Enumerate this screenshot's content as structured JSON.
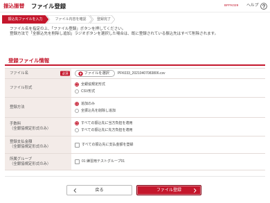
{
  "colors": {
    "primary": "#c4172c",
    "label_bg": "#f3ebe8"
  },
  "header": {
    "category": "振込振替",
    "title": "ファイル登録",
    "screen_id": "BFFK029",
    "help_label": "ヘルプ",
    "help_icon": "question-circle-icon"
  },
  "steps": [
    {
      "label": "振込先ファイルを入力",
      "active": true
    },
    {
      "label": "ファイル内容を確認",
      "active": false
    },
    {
      "label": "登録完了",
      "active": false
    }
  ],
  "instructions": [
    "ファイル名を指定の上、「ファイル登録」ボタンを押してください。",
    "登録方法で「全振込先を削除し追加」ラジオボタンを選択した場合は、既に登録されている振込先はすべて削除されます。"
  ],
  "section": {
    "title": "登録ファイル情報"
  },
  "form": {
    "file_name": {
      "label": "ファイル名",
      "required_badge": "必須",
      "select_button": "ファイルを選択",
      "select_icon": "upload-icon",
      "value": "PFK033_20210407083806.csv"
    },
    "file_format": {
      "label": "ファイル形式",
      "options": [
        {
          "label": "全銀協規定形式",
          "checked": true
        },
        {
          "label": "CSV形式",
          "checked": false
        }
      ]
    },
    "registration_method": {
      "label": "登録方法",
      "options": [
        {
          "label": "追加のみ",
          "checked": true
        },
        {
          "label": "全振込先を削除し追加",
          "checked": false
        }
      ]
    },
    "fee": {
      "label": "手数料",
      "note": "（全銀協規定形式のみ）",
      "options": [
        {
          "label": "すべての振込先に当方負担を適用",
          "checked": true
        },
        {
          "label": "すべての振込先に先方負担を適用",
          "checked": false
        }
      ]
    },
    "payment_amount": {
      "label": "登録支払金額",
      "note": "（全銀協規定形式のみ）",
      "checkbox": {
        "label": "すべての振込先に支払金額を登録",
        "checked": false
      }
    },
    "group": {
      "label": "所属グループ",
      "note": "（全銀協規定形式のみ）",
      "checkbox": {
        "label": "01 練習用テストグループ01",
        "checked": false
      }
    }
  },
  "buttons": {
    "back": {
      "label": "戻る",
      "icon": "chevron-left-icon"
    },
    "submit": {
      "label": "ファイル登録",
      "icon": "chevron-right-icon"
    }
  }
}
